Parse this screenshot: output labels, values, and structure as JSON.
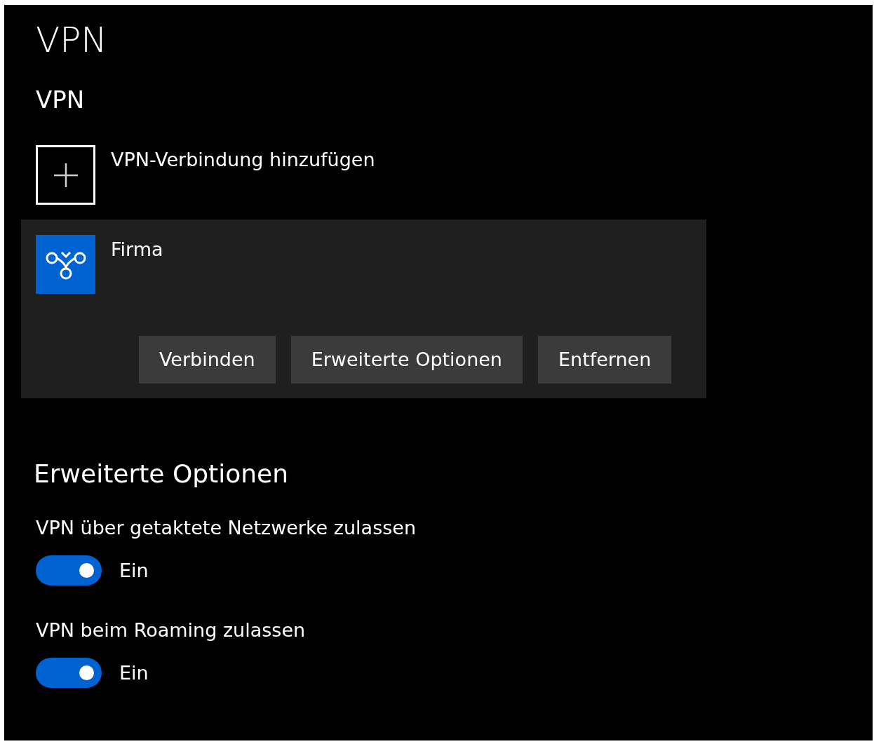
{
  "page_title": "VPN",
  "section_title": "VPN",
  "add_connection": {
    "label": "VPN-Verbindung hinzufügen"
  },
  "connections": [
    {
      "name": "Firma",
      "expanded": true,
      "buttons": [
        "Verbinden",
        "Erweiterte Optionen",
        "Entfernen"
      ]
    }
  ],
  "advanced": {
    "title": "Erweiterte Optionen",
    "settings": [
      {
        "label": "VPN über getaktete Netzwerke zulassen",
        "on": true,
        "state_text": "Ein"
      },
      {
        "label": "VPN beim Roaming zulassen",
        "on": true,
        "state_text": "Ein"
      }
    ]
  }
}
